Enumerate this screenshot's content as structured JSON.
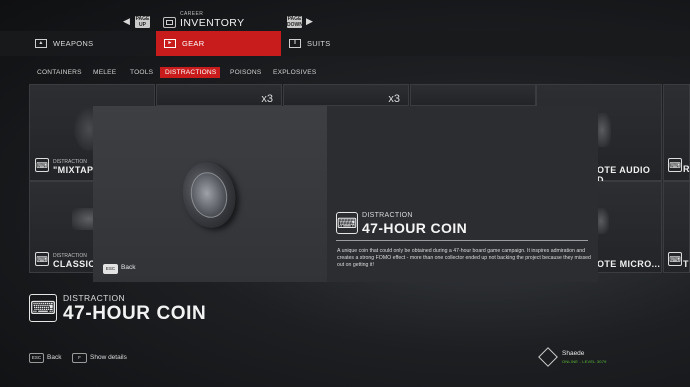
{
  "header": {
    "page_up": "PAGE UP",
    "page_down": "PAGE DOWN",
    "category_small": "CAREER",
    "title": "INVENTORY"
  },
  "categories": [
    {
      "label": "WEAPONS"
    },
    {
      "label": "GEAR"
    },
    {
      "label": "SUITS"
    }
  ],
  "subtabs": [
    "CONTAINERS",
    "MELEE",
    "TOOLS",
    "DISTRACTIONS",
    "POISONS",
    "EXPLOSIVES"
  ],
  "tiles": {
    "row1": [
      {
        "type": "DISTRACTION",
        "name": "\"MIXTAPE"
      },
      {
        "count": "x3"
      },
      {
        "count": "x3"
      },
      {
        "name": "OTE AUDIO D..."
      },
      {
        "name": "R"
      }
    ],
    "row2": [
      {
        "type": "DISTRACTION",
        "name": "CLASSIC"
      },
      {
        "name": "OTE MICRO..."
      },
      {
        "name": "T"
      }
    ]
  },
  "modal": {
    "back_key": "ESC",
    "back_label": "Back",
    "item_type": "DISTRACTION",
    "item_name": "47-HOUR COIN",
    "description": "A unique coin that could only be obtained during a 47-hour board game campaign. It inspires admiration and creates a strong FOMO effect - more than one collector ended up not backing the project because they missed out on getting it!"
  },
  "selected": {
    "type": "DISTRACTION",
    "name": "47-HOUR COIN"
  },
  "footer": {
    "back_key": "ESC",
    "back_label": "Back",
    "details_key": "F",
    "details_label": "Show details"
  },
  "profile": {
    "name": "Shaede",
    "status": "ONLINE - LEVEL 3079"
  },
  "colors": {
    "accent": "#c81c1c",
    "online": "#5fbf3a"
  }
}
